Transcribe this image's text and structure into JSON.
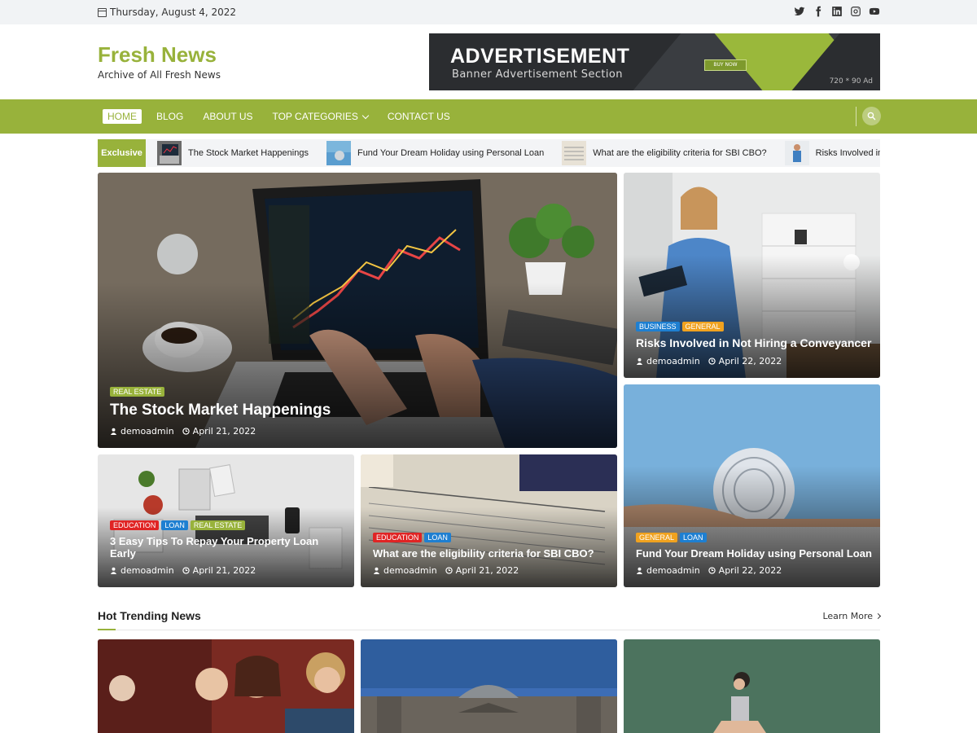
{
  "topbar": {
    "date": "Thursday, August 4, 2022",
    "social_icons": [
      "twitter-icon",
      "facebook-icon",
      "linkedin-icon",
      "instagram-icon",
      "youtube-icon"
    ]
  },
  "brand": {
    "title": "Fresh News",
    "tagline": "Archive of All Fresh News",
    "color": "#98b23b"
  },
  "ad": {
    "title": "ADVERTISEMENT",
    "subtitle": "Banner Advertisement Section",
    "button": "BUY NOW",
    "size": "720 * 90 Ad"
  },
  "nav": {
    "items": [
      {
        "label": "HOME"
      },
      {
        "label": "BLOG"
      },
      {
        "label": "ABOUT US"
      },
      {
        "label": "TOP CATEGORIES"
      },
      {
        "label": "CONTACT US"
      }
    ]
  },
  "ticker": {
    "label": "Exclusive",
    "items": [
      {
        "text": "The Stock Market Happenings"
      },
      {
        "text": "Fund Your Dream Holiday using Personal Loan"
      },
      {
        "text": "What are the eligibility criteria for SBI CBO?"
      },
      {
        "text": "Risks Involved in Not Hiring a Conveyancer"
      }
    ]
  },
  "featured": {
    "main": {
      "tags": [
        "REAL ESTATE"
      ],
      "title": "The Stock Market Happenings",
      "author": "demoadmin",
      "date": "April 21, 2022"
    },
    "right_top": {
      "tags": [
        "BUSINESS",
        "GENERAL"
      ],
      "title": "Risks Involved in Not Hiring a Conveyancer",
      "author": "demoadmin",
      "date": "April 22, 2022"
    },
    "bottom_left": {
      "tags": [
        "EDUCATION",
        "LOAN",
        "REAL ESTATE"
      ],
      "title": "3 Easy Tips To Repay Your Property Loan Early",
      "author": "demoadmin",
      "date": "April 21, 2022"
    },
    "bottom_mid": {
      "tags": [
        "EDUCATION",
        "LOAN"
      ],
      "title": "What are the eligibility criteria for SBI CBO?",
      "author": "demoadmin",
      "date": "April 21, 2022"
    },
    "right_bottom": {
      "tags": [
        "GENERAL",
        "LOAN"
      ],
      "title": "Fund Your Dream Holiday using Personal Loan",
      "author": "demoadmin",
      "date": "April 22, 2022"
    }
  },
  "trending": {
    "title": "Hot Trending News",
    "link": "Learn More"
  }
}
